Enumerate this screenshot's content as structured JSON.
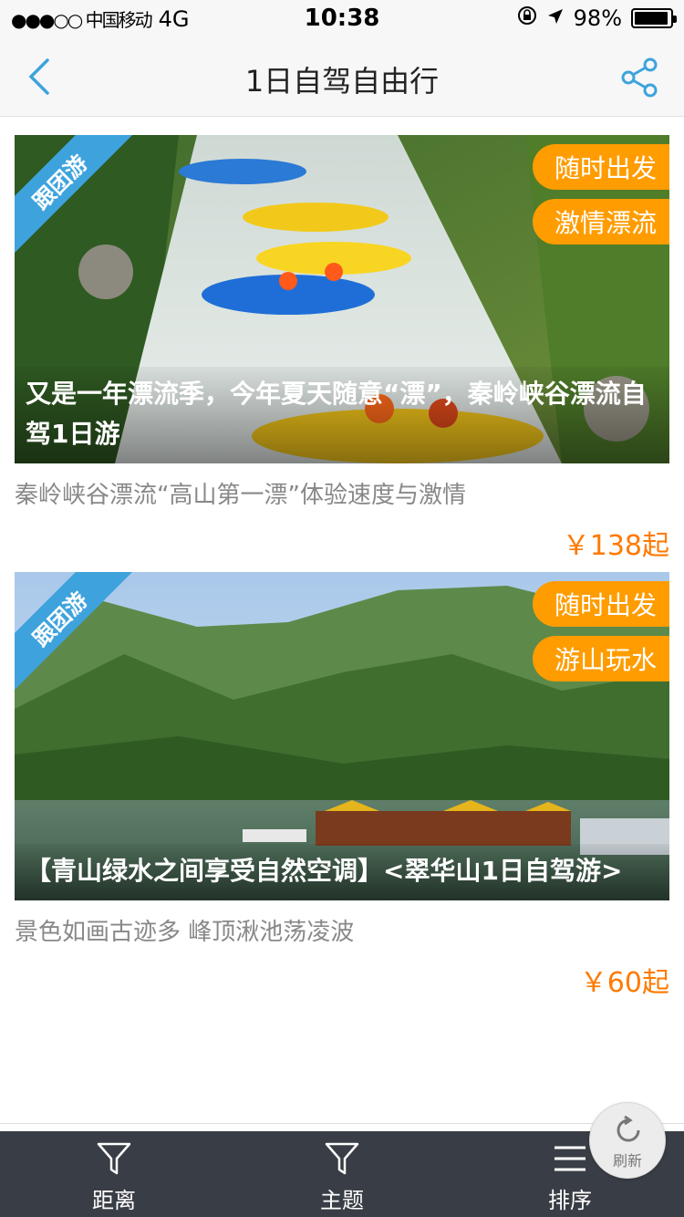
{
  "status_bar": {
    "carrier": "●●●○○ 中国移动",
    "network": "4G",
    "time": "10:38",
    "battery": "98%"
  },
  "nav": {
    "title": "1日自驾自由行",
    "back_icon": "chevron-left-icon",
    "share_icon": "share-icon"
  },
  "colors": {
    "accent": "#3ea3dd",
    "tag": "#ff9c00",
    "price": "#ff7a00",
    "tab_bar": "#393d45"
  },
  "cards": [
    {
      "ribbon": "跟团游",
      "tags": [
        "随时出发",
        "激情漂流"
      ],
      "caption": "又是一年漂流季，今年夏天随意“漂”，秦岭峡谷漂流自驾1日游",
      "subtitle": "秦岭峡谷漂流“高山第一漂”体验速度与激情",
      "price": "￥138起"
    },
    {
      "ribbon": "跟团游",
      "tags": [
        "随时出发",
        "游山玩水"
      ],
      "caption": "【青山绿水之间享受自然空调】<翠华山1日自驾游>",
      "subtitle": "景色如画古迹多 峰顶湫池荡凌波",
      "price": "￥60起"
    }
  ],
  "refresh": {
    "label": "刷新",
    "icon": "refresh-icon"
  },
  "tabs": [
    {
      "label": "距离",
      "icon": "filter-icon"
    },
    {
      "label": "主题",
      "icon": "filter-icon"
    },
    {
      "label": "排序",
      "icon": "menu-icon"
    }
  ]
}
